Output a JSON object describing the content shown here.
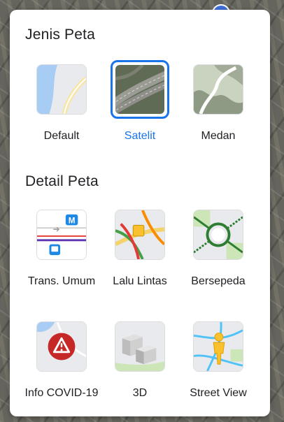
{
  "map_types": {
    "title": "Jenis Peta",
    "items": [
      {
        "label": "Default",
        "selected": false
      },
      {
        "label": "Satelit",
        "selected": true
      },
      {
        "label": "Medan",
        "selected": false
      }
    ]
  },
  "map_details": {
    "title": "Detail Peta",
    "items": [
      {
        "label": "Trans. Umum"
      },
      {
        "label": "Lalu Lintas"
      },
      {
        "label": "Bersepeda"
      },
      {
        "label": "Info COVID-19"
      },
      {
        "label": "3D"
      },
      {
        "label": "Street View"
      }
    ]
  },
  "colors": {
    "accent": "#1a73e8",
    "text": "#202124"
  }
}
